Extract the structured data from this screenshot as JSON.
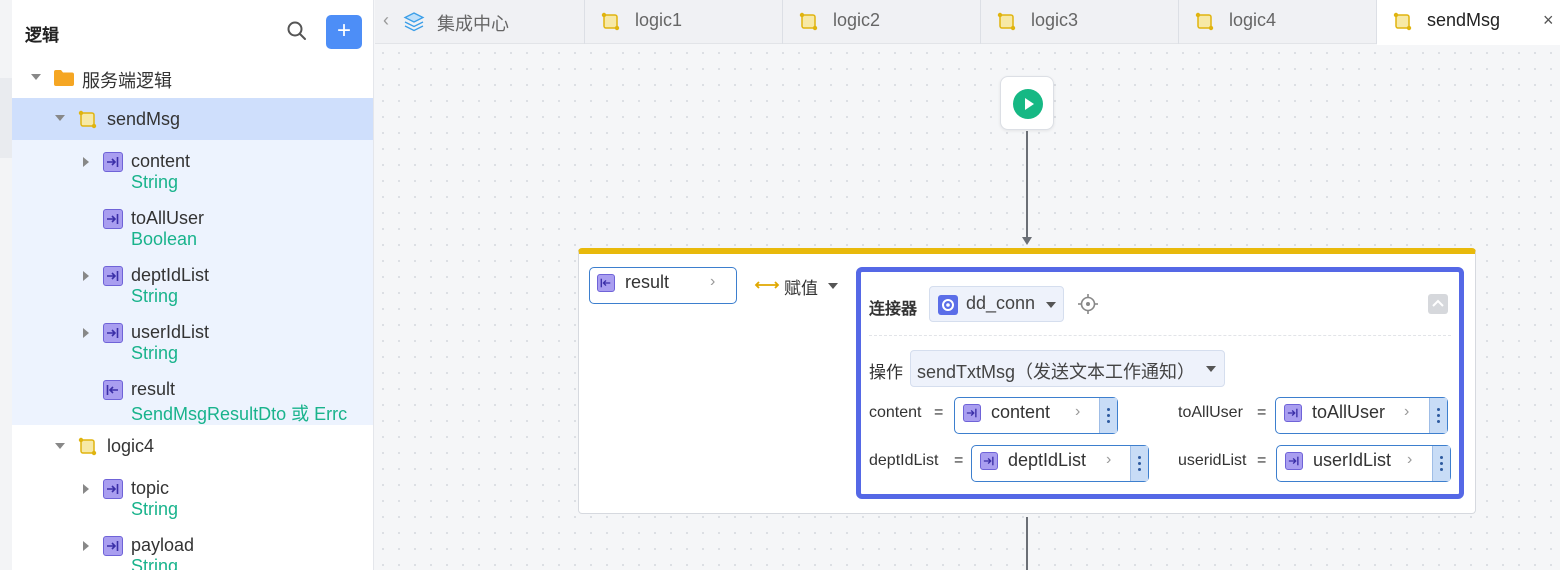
{
  "sidebar": {
    "title": "逻辑",
    "folder": {
      "label": "服务端逻辑"
    },
    "logics": [
      {
        "label": "sendMsg",
        "params": [
          {
            "name": "content",
            "type": "String"
          },
          {
            "name": "toAllUser",
            "type": "Boolean"
          },
          {
            "name": "deptIdList",
            "type": "String"
          },
          {
            "name": "userIdList",
            "type": "String"
          },
          {
            "name": "result",
            "type": "SendMsgResultDto 或 Errc"
          }
        ]
      },
      {
        "label": "logic4",
        "params": [
          {
            "name": "topic",
            "type": "String"
          },
          {
            "name": "payload",
            "type": "String"
          }
        ]
      }
    ]
  },
  "tabs": [
    {
      "label": "集成中心"
    },
    {
      "label": "logic1"
    },
    {
      "label": "logic2"
    },
    {
      "label": "logic3"
    },
    {
      "label": "logic4"
    },
    {
      "label": "sendMsg"
    }
  ],
  "tab_close": "×",
  "assign": {
    "target": "result",
    "action_label": "赋值",
    "connector": {
      "label": "连接器",
      "name": "dd_conn",
      "operation_label": "操作",
      "operation": "sendTxtMsg（发送文本工作通知）",
      "fields": [
        {
          "key": "content",
          "eq": "=",
          "value": "content"
        },
        {
          "key": "toAllUser",
          "eq": "=",
          "value": "toAllUser"
        },
        {
          "key": "deptIdList",
          "eq": "=",
          "value": "deptIdList"
        },
        {
          "key": "useridList",
          "eq": "=",
          "value": "userIdList"
        }
      ]
    }
  },
  "colors": {
    "accent": "#4d8ef7",
    "type_text": "#19b38c",
    "param_icon": "#a99ef0",
    "connector_border": "#5568e6",
    "assign_top": "#e8b90b",
    "start": "#16b884"
  }
}
